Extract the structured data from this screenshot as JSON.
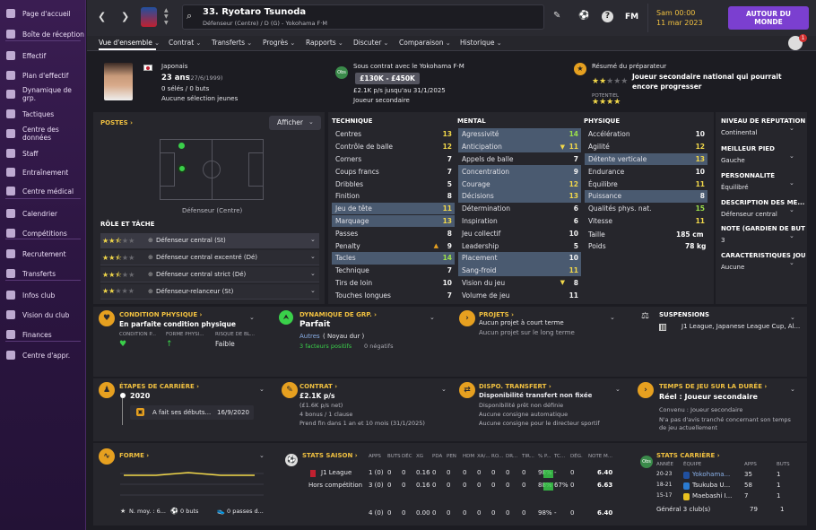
{
  "sidebar": {
    "items": [
      {
        "label": "Page d'accueil"
      },
      {
        "label": "Boîte de réception"
      },
      {
        "label": "Effectif"
      },
      {
        "label": "Plan d'effectif"
      },
      {
        "label": "Dynamique de grp."
      },
      {
        "label": "Tactiques"
      },
      {
        "label": "Centre des données"
      },
      {
        "label": "Staff"
      },
      {
        "label": "Entraînement"
      },
      {
        "label": "Centre médical"
      },
      {
        "label": "Calendrier"
      },
      {
        "label": "Compétitions"
      },
      {
        "label": "Recrutement"
      },
      {
        "label": "Transferts"
      },
      {
        "label": "Infos club"
      },
      {
        "label": "Vision du club"
      },
      {
        "label": "Finances"
      },
      {
        "label": "Centre d'appr."
      }
    ]
  },
  "header": {
    "player_name": "33. Ryotaro Tsunoda",
    "subtitle": "Défenseur (Centre) / D (G) - Yokohama F·M",
    "date_line1": "Sam 00:00",
    "date_line2": "11 mar 2023",
    "continue_label": "AUTOUR DU MONDE",
    "fm_label": "FM",
    "notif_count": "1"
  },
  "subnav": {
    "tabs": [
      "Vue d'ensemble",
      "Contrat",
      "Transferts",
      "Progrès",
      "Rapports",
      "Discuter",
      "Comparaison",
      "Historique"
    ]
  },
  "profile": {
    "nationality": "Japonais",
    "age": "23 ans",
    "dob": "(27/6/1999)",
    "caps": "0 sélés / 0 buts",
    "youth": "Aucune sélection jeunes",
    "contract": "Sous contrat avec le Yokohama F·M",
    "value": "£130K - £450K",
    "wage": "£2.1K p/s jusqu'au 31/1/2025",
    "role": "Joueur secondaire",
    "coach_label": "Résumé du préparateur",
    "coach_text": "Joueur secondaire national qui pourrait encore progresser",
    "potentiel": "POTENTIEL"
  },
  "positions": {
    "header": "POSTES",
    "afficher": "Afficher",
    "pos_label": "Défenseur (Centre)",
    "role_header": "RÔLE ET TÂCHE",
    "roles": [
      {
        "name": "Défenseur central (St)"
      },
      {
        "name": "Défenseur central excentré (Dé)"
      },
      {
        "name": "Défenseur central strict (Dé)"
      },
      {
        "name": "Défenseur-relanceur (St)"
      }
    ]
  },
  "technique": {
    "header": "TECHNIQUE",
    "rows": [
      [
        "Centres",
        "13"
      ],
      [
        "Contrôle de balle",
        "12"
      ],
      [
        "Corners",
        "7"
      ],
      [
        "Coups francs",
        "7"
      ],
      [
        "Dribbles",
        "5"
      ],
      [
        "Finition",
        "8"
      ],
      [
        "Jeu de tête",
        "11"
      ],
      [
        "Marquage",
        "13"
      ],
      [
        "Passes",
        "8"
      ],
      [
        "Penalty",
        "9"
      ],
      [
        "Tacles",
        "14"
      ],
      [
        "Technique",
        "7"
      ],
      [
        "Tirs de loin",
        "10"
      ],
      [
        "Touches longues",
        "7"
      ]
    ]
  },
  "mental": {
    "header": "MENTAL",
    "rows": [
      [
        "Agressivité",
        "14"
      ],
      [
        "Anticipation",
        "11"
      ],
      [
        "Appels de balle",
        "7"
      ],
      [
        "Concentration",
        "9"
      ],
      [
        "Courage",
        "12"
      ],
      [
        "Décisions",
        "13"
      ],
      [
        "Détermination",
        "6"
      ],
      [
        "Inspiration",
        "6"
      ],
      [
        "Jeu collectif",
        "10"
      ],
      [
        "Leadership",
        "5"
      ],
      [
        "Placement",
        "10"
      ],
      [
        "Sang-froid",
        "11"
      ],
      [
        "Vision du jeu",
        "8"
      ],
      [
        "Volume de jeu",
        "11"
      ]
    ]
  },
  "physique": {
    "header": "PHYSIQUE",
    "rows": [
      [
        "Accélération",
        "10"
      ],
      [
        "Agilité",
        "12"
      ],
      [
        "Détente verticale",
        "13"
      ],
      [
        "Endurance",
        "10"
      ],
      [
        "Équilibre",
        "11"
      ],
      [
        "Puissance",
        "8"
      ],
      [
        "Qualités phys. nat.",
        "15"
      ],
      [
        "Vitesse",
        "11"
      ]
    ],
    "taille_label": "Taille",
    "taille": "185 cm",
    "poids_label": "Poids",
    "poids": "78 kg"
  },
  "right_info": [
    {
      "h": "NIVEAU DE RÉPUTATION",
      "v": "Continental"
    },
    {
      "h": "MEILLEUR PIED",
      "v": "Gauche"
    },
    {
      "h": "PERSONNALITÉ",
      "v": "Équilibré"
    },
    {
      "h": "DESCRIPTION DES MÉ...",
      "v": "Défenseur central"
    },
    {
      "h": "NOTE (GARDIEN DE BUT)",
      "v": "3"
    },
    {
      "h": "CARACTÉRISTIQUES JOU",
      "v": "Aucune"
    }
  ],
  "cond": {
    "h": "CONDITION PHYSIQUE",
    "v": "En parfaite condition physique",
    "c1": "CONDITION P...",
    "c2": "FORME PHYSI...",
    "c3": "RISQUE DE BL...",
    "c3v": "Faible"
  },
  "dyn": {
    "h": "DYNAMIQUE DE GRP.",
    "v": "Parfait",
    "l1": "Autres",
    "l1b": "( Noyau dur )",
    "l2": "3 facteurs positifs",
    "l3": "0 négatifs"
  },
  "projets": {
    "h": "PROJETS",
    "v": "Aucun projet à court terme",
    "v2": "Aucun projet sur le long terme"
  },
  "susp": {
    "h": "SUSPENSIONS",
    "v": "J1 League, Japanese League Cup, Al..."
  },
  "career": {
    "h": "ÉTAPES DE CARRIÈRE",
    "year": "2020",
    "evt": "A fait ses débuts...",
    "date": "16/9/2020"
  },
  "contract": {
    "h": "CONTRAT",
    "v": "£2.1K p/s",
    "l1": "(£1.6K p/s net)",
    "l2": "4 bonus / 1 clause",
    "l3": "Prend fin dans 1 an et 10 mois (31/1/2025)"
  },
  "dispo": {
    "h": "DISPO. TRANSFERT",
    "v": "Disponibilité transfert non fixée",
    "l1": "Disponibilité prêt non définie",
    "l2": "Aucune consigne automatique",
    "l3": "Aucune consigne pour le directeur sportif"
  },
  "temps": {
    "h": "TEMPS DE JEU SUR LA DURÉE",
    "v": "Réel : Joueur secondaire",
    "l1": "Convenu : Joueur secondaire",
    "l2": "N'a pas d'avis tranché concernant son temps de jeu actuellement"
  },
  "forme": {
    "h": "FORME",
    "l1": "N. moy. : 6...",
    "l2": "0 buts",
    "l3": "0 passes d..."
  },
  "stats": {
    "h": "STATS SAISON",
    "cols": [
      "APPS",
      "BUTS",
      "DÉC",
      "XG",
      "PDA",
      "PEN",
      "HDM",
      "XA/...",
      "RO...",
      "DR...",
      "TIR...",
      "% P...",
      "TC...",
      "DÉG.",
      "NOTE M..."
    ],
    "rows": [
      {
        "name": "J1 League",
        "vals": [
          "1 (0)",
          "0",
          "0",
          "0.16",
          "0",
          "0",
          "0",
          "0",
          "0",
          "0",
          "0",
          "98%",
          "-",
          "0",
          "6.40"
        ]
      },
      {
        "name": "Hors compétition",
        "vals": [
          "3 (0)",
          "0",
          "0",
          "0.16",
          "0",
          "0",
          "0",
          "0",
          "0",
          "0",
          "0",
          "88%",
          "67%",
          "0",
          "6.63"
        ]
      },
      {
        "name": "",
        "vals": [
          "4 (0)",
          "0",
          "0",
          "0.00",
          "0",
          "0",
          "0",
          "0",
          "0",
          "0",
          "0",
          "98%",
          "-",
          "0",
          "6.40"
        ]
      }
    ]
  },
  "career_stats": {
    "h": "STATS CARRIÈRE",
    "cols": [
      "ANNÉE",
      "ÉQUIPE",
      "APPS",
      "BUTS"
    ],
    "rows": [
      [
        "20-23",
        "Yokohama...",
        "35",
        "1"
      ],
      [
        "18-21",
        "Tsukuba U...",
        "58",
        "1"
      ],
      [
        "15-17",
        "Maebashi I...",
        "7",
        "1"
      ]
    ],
    "total_label": "Général 3 club(s)",
    "total_apps": "79",
    "total_goals": "1"
  },
  "colors": {
    "accent": "#f0c040",
    "brand": "#7b3fd0",
    "highlight": "#4a5a70"
  }
}
